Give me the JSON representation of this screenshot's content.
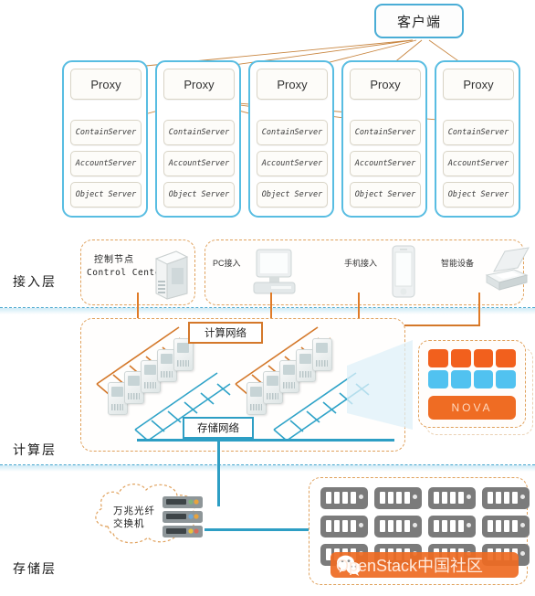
{
  "diagram": {
    "title_box": {
      "label": "客户端",
      "name": "client"
    },
    "proxy_columns": [
      {
        "proxy": "Proxy",
        "container": "ContainServer",
        "account": "AccountServer",
        "object": "Object Server"
      },
      {
        "proxy": "Proxy",
        "container": "ContainServer",
        "account": "AccountServer",
        "object": "Object Server"
      },
      {
        "proxy": "Proxy",
        "container": "ContainServer",
        "account": "AccountServer",
        "object": "Object Server"
      },
      {
        "proxy": "Proxy",
        "container": "ContainServer",
        "account": "AccountServer",
        "object": "Object Server"
      },
      {
        "proxy": "Proxy",
        "container": "ContainServer",
        "account": "AccountServer",
        "object": "Object Server"
      }
    ],
    "layers": [
      {
        "id": "access",
        "label": "接入层"
      },
      {
        "id": "compute",
        "label": "计算层"
      },
      {
        "id": "storage",
        "label": "存储层"
      }
    ],
    "access_layer": {
      "control_center": {
        "cn": "控制节点",
        "en": "Control Center"
      },
      "endpoints": [
        {
          "label": "PC接入",
          "icon": "desktop-pc-icon"
        },
        {
          "label": "手机接入",
          "icon": "mobile-phone-icon"
        },
        {
          "label": "智能设备",
          "icon": "smart-device-icon"
        }
      ]
    },
    "compute_layer": {
      "compute_network_tag": "计算网络",
      "storage_network_tag": "存储网络",
      "nova": {
        "label": "NOVA",
        "top_squares": 4,
        "bottom_squares": 4,
        "top_color": "#f2601d",
        "bottom_color": "#51c2f0",
        "bar_color": "#ef6c23"
      },
      "clusters": [
        {
          "servers": 5
        },
        {
          "servers": 5
        }
      ]
    },
    "storage_layer": {
      "cloud": {
        "line1": "万兆光纤",
        "line2": "交换机"
      },
      "rack": {
        "rows": 3,
        "cols": 4
      }
    },
    "watermark": {
      "text": "OpenStack中国社区",
      "logo": "wechat-logo-icon",
      "bar_color": "#ee6a22"
    },
    "colors": {
      "proxy_border": "#58bde2",
      "client_border": "#4aadd6",
      "compute_network": "#d4782a",
      "storage_network": "#2d9ec4",
      "dashed_group": "#e0a15c",
      "divider": "#4aa8cf"
    }
  }
}
